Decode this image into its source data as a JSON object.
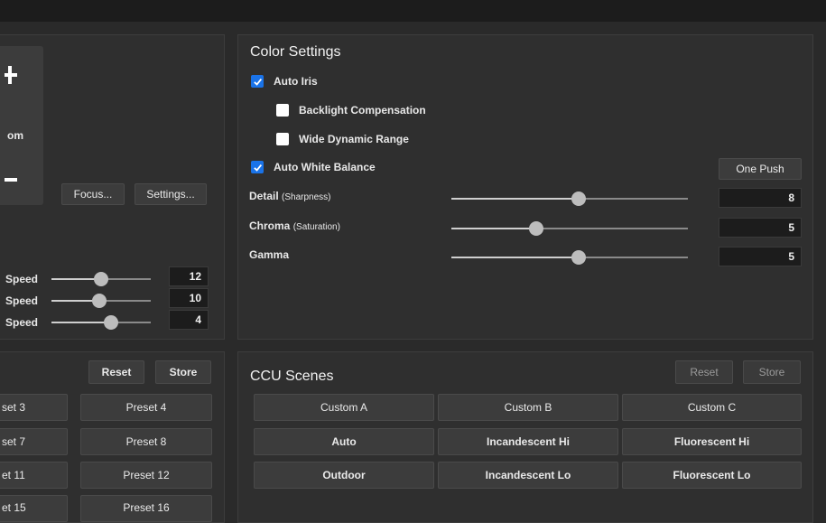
{
  "camera": {
    "zoom_label": "om",
    "focus_label": "Focus...",
    "settings_label": "Settings...",
    "speeds": [
      {
        "label": "Speed",
        "value": "12",
        "level": 0.5
      },
      {
        "label": "Speed",
        "value": "10",
        "level": 0.48
      },
      {
        "label": "Speed",
        "value": "4",
        "level": 0.6
      }
    ]
  },
  "color": {
    "title": "Color Settings",
    "auto_iris": {
      "label": "Auto Iris",
      "checked": true
    },
    "backlight": {
      "label": "Backlight Compensation",
      "checked": false
    },
    "wdr": {
      "label": "Wide Dynamic Range",
      "checked": false
    },
    "awb": {
      "label": "Auto White Balance",
      "checked": true
    },
    "one_push_label": "One Push",
    "detail": {
      "label": "Detail",
      "sub": "(Sharpness)",
      "value": "8",
      "level": 0.54
    },
    "chroma": {
      "label": "Chroma",
      "sub": "(Saturation)",
      "value": "5",
      "level": 0.36
    },
    "gamma": {
      "label": "Gamma",
      "value": "5",
      "level": 0.54
    }
  },
  "presets": {
    "reset_label": "Reset",
    "store_label": "Store",
    "items": [
      "set 3",
      "Preset 4",
      "set 7",
      "Preset 8",
      "et 11",
      "Preset 12",
      "et 15",
      "Preset 16"
    ]
  },
  "ccu": {
    "title": "CCU Scenes",
    "reset_label": "Reset",
    "store_label": "Store",
    "scenes": [
      "Custom A",
      "Custom B",
      "Custom C",
      "Auto",
      "Incandescent Hi",
      "Fluorescent Hi",
      "Outdoor",
      "Incandescent Lo",
      "Fluorescent Lo"
    ]
  }
}
